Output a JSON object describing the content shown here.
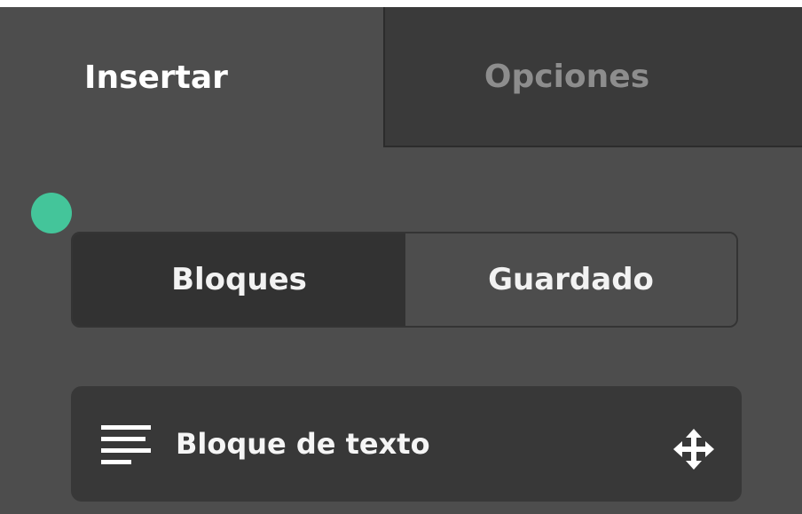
{
  "tabs": {
    "insertar": "Insertar",
    "opciones": "Opciones"
  },
  "segmented": {
    "bloques": "Bloques",
    "guardado": "Guardado"
  },
  "block": {
    "label": "Bloque de texto",
    "icon": "text-lines-icon",
    "drag_icon": "move-icon"
  },
  "colors": {
    "panel_bg": "#4d4d4d",
    "accent_dot": "#44c59a",
    "active_segment": "#323232",
    "inactive_tab": "#3a3a3a"
  }
}
